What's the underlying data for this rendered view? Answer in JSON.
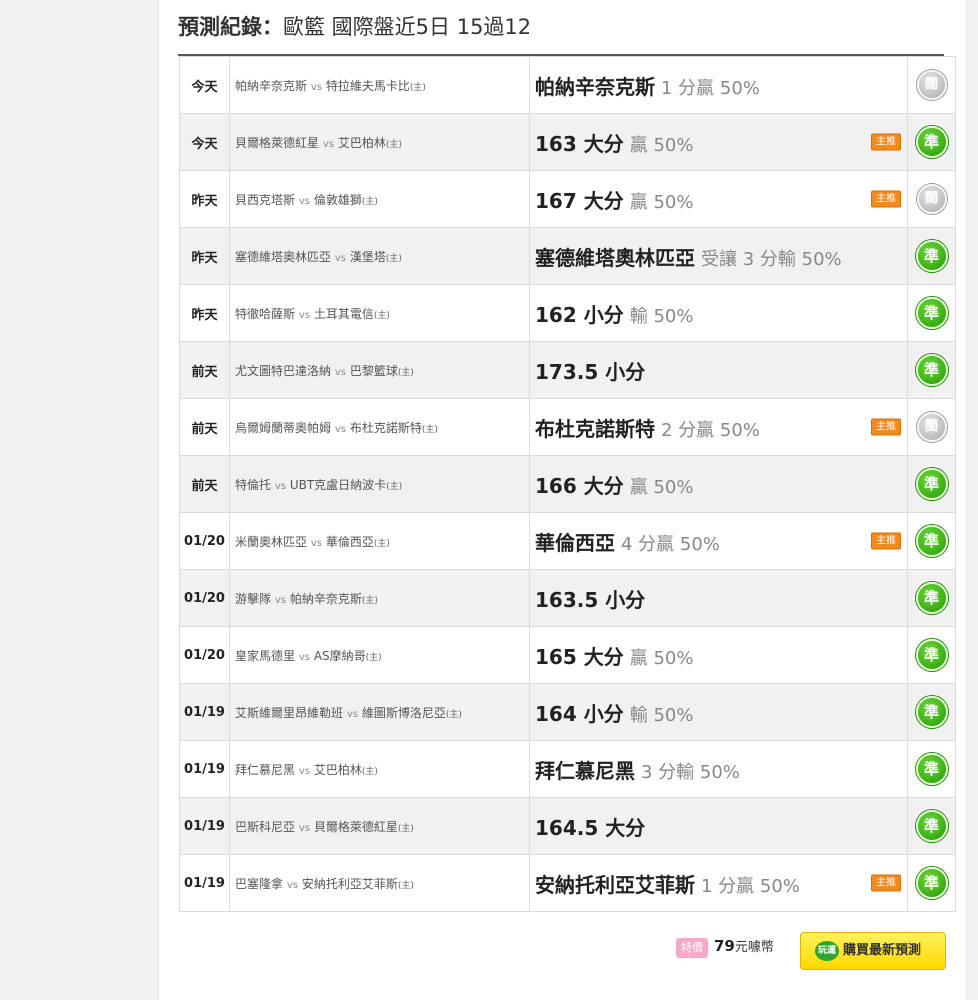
{
  "header": {
    "title": "預測紀錄：",
    "subtitle": "歐籃 國際盤近5日 15過12"
  },
  "records": [
    {
      "date": "今天",
      "away": "帕納辛奈克斯",
      "vs": "vs",
      "home": "特拉維夫馬卡比",
      "home_mark": "(主)",
      "pick": "帕納辛奈克斯",
      "detail": "1 分贏 50%",
      "badge": "",
      "result": "push",
      "result_label": "闊"
    },
    {
      "date": "今天",
      "away": "貝爾格萊德紅星",
      "vs": "vs",
      "home": "艾巴柏林",
      "home_mark": "(主)",
      "pick": "163 大分",
      "detail": "贏 50%",
      "badge": "主推",
      "result": "win",
      "result_label": "準"
    },
    {
      "date": "昨天",
      "away": "貝西克塔斯",
      "vs": "vs",
      "home": "倫敦雄獅",
      "home_mark": "(主)",
      "pick": "167 大分",
      "detail": "贏 50%",
      "badge": "主推",
      "result": "push",
      "result_label": "闊"
    },
    {
      "date": "昨天",
      "away": "塞德維塔奧林匹亞",
      "vs": "vs",
      "home": "漢堡塔",
      "home_mark": "(主)",
      "pick": "塞德維塔奧林匹亞",
      "detail": "受讓 3 分輸 50%",
      "badge": "",
      "result": "win",
      "result_label": "準"
    },
    {
      "date": "昨天",
      "away": "特徹哈薩斯",
      "vs": "vs",
      "home": "土耳其電信",
      "home_mark": "(主)",
      "pick": "162 小分",
      "detail": "輸 50%",
      "badge": "",
      "result": "win",
      "result_label": "準"
    },
    {
      "date": "前天",
      "away": "尤文圖特巴達洛納",
      "vs": "vs",
      "home": "巴黎籃球",
      "home_mark": "(主)",
      "pick": "173.5 小分",
      "detail": "",
      "badge": "",
      "result": "win",
      "result_label": "準"
    },
    {
      "date": "前天",
      "away": "烏爾姆蘭蒂奧帕姆",
      "vs": "vs",
      "home": "布杜克諾斯特",
      "home_mark": "(主)",
      "pick": "布杜克諾斯特",
      "detail": "2 分贏 50%",
      "badge": "主推",
      "result": "push",
      "result_label": "闊"
    },
    {
      "date": "前天",
      "away": "特倫托",
      "vs": "vs",
      "home": "UBT克盧日納波卡",
      "home_mark": "(主)",
      "pick": "166 大分",
      "detail": "贏 50%",
      "badge": "",
      "result": "win",
      "result_label": "準"
    },
    {
      "date": "01/20",
      "away": "米蘭奧林匹亞",
      "vs": "vs",
      "home": "華倫西亞",
      "home_mark": "(主)",
      "pick": "華倫西亞",
      "detail": "4 分贏 50%",
      "badge": "主推",
      "result": "win",
      "result_label": "準"
    },
    {
      "date": "01/20",
      "away": "游擊隊",
      "vs": "vs",
      "home": "帕納辛奈克斯",
      "home_mark": "(主)",
      "pick": "163.5 小分",
      "detail": "",
      "badge": "",
      "result": "win",
      "result_label": "準"
    },
    {
      "date": "01/20",
      "away": "皇家馬德里",
      "vs": "vs",
      "home": "AS摩納哥",
      "home_mark": "(主)",
      "pick": "165 大分",
      "detail": "贏 50%",
      "badge": "",
      "result": "win",
      "result_label": "準"
    },
    {
      "date": "01/19",
      "away": "艾斯維爾里昂維勒班",
      "vs": "vs",
      "home": "維圖斯博洛尼亞",
      "home_mark": "(主)",
      "pick": "164 小分",
      "detail": "輸 50%",
      "badge": "",
      "result": "win",
      "result_label": "準"
    },
    {
      "date": "01/19",
      "away": "拜仁慕尼黑",
      "vs": "vs",
      "home": "艾巴柏林",
      "home_mark": "(主)",
      "pick": "拜仁慕尼黑",
      "detail": "3 分輸 50%",
      "badge": "",
      "result": "win",
      "result_label": "準"
    },
    {
      "date": "01/19",
      "away": "巴斯科尼亞",
      "vs": "vs",
      "home": "貝爾格萊德紅星",
      "home_mark": "(主)",
      "pick": "164.5 大分",
      "detail": "",
      "badge": "",
      "result": "win",
      "result_label": "準"
    },
    {
      "date": "01/19",
      "away": "巴塞隆拿",
      "vs": "vs",
      "home": "安納托利亞艾菲斯",
      "home_mark": "(主)",
      "pick": "安納托利亞艾菲斯",
      "detail": "1 分贏 50%",
      "badge": "主推",
      "result": "win",
      "result_label": "準"
    }
  ],
  "footer": {
    "special_label": "特價",
    "price": "79",
    "price_unit": "元噱幣",
    "buy_icon": "玩運",
    "buy_label": "購買最新預測"
  },
  "colors": {
    "win": "#1f9b00",
    "push": "#a9a9a9",
    "badge": "#f28a1e",
    "buy": "#ffd800"
  }
}
